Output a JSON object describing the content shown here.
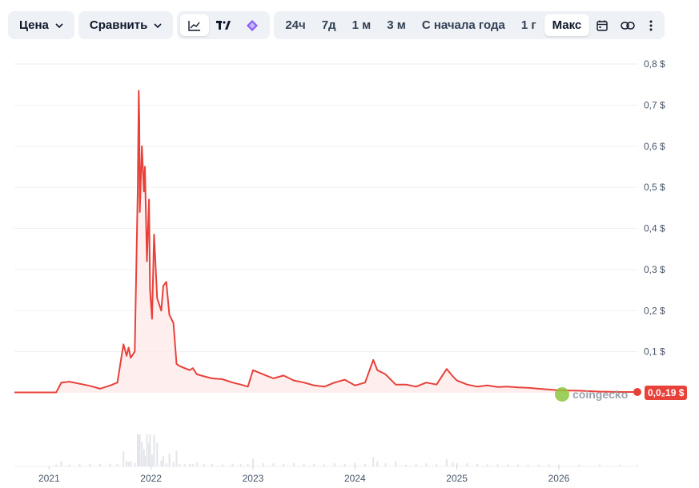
{
  "toolbar": {
    "price_dropdown": "Цена",
    "compare_dropdown": "Сравнить",
    "ranges": [
      "24ч",
      "7д",
      "1 м",
      "3 м",
      "С начала года",
      "1 г",
      "Макс"
    ],
    "active_range": "Макс"
  },
  "badge": {
    "current_price": "0,0₂19 $"
  },
  "watermark": {
    "text": "coingecko"
  },
  "colors": {
    "line": "#e8413a",
    "fill": "#fde8e7",
    "grid": "#eceff3",
    "volume": "#e2e5ea"
  },
  "chart_data": {
    "type": "line",
    "title": "",
    "xlabel": "",
    "ylabel": "",
    "ylim": [
      0,
      0.8
    ],
    "y_ticks": [
      0.1,
      0.2,
      0.3,
      0.4,
      0.5,
      0.6,
      0.7,
      0.8
    ],
    "y_tick_labels": [
      "0,1 $",
      "0,2 $",
      "0,3 $",
      "0,4 $",
      "0,5 $",
      "0,6 $",
      "0,7 $",
      "0,8 $"
    ],
    "x_range": [
      2020.66,
      2026.77
    ],
    "x_ticks": [
      2021,
      2022,
      2023,
      2024,
      2025,
      2026
    ],
    "x_tick_labels": [
      "2021",
      "2022",
      "2023",
      "2024",
      "2025",
      "2026"
    ],
    "grid": true,
    "series": [
      {
        "x": [
          2020.66,
          2021.07,
          2021.12,
          2021.2,
          2021.3,
          2021.4,
          2021.5,
          2021.6,
          2021.67,
          2021.73,
          2021.76,
          2021.78,
          2021.8,
          2021.84,
          2021.87,
          2021.88,
          2021.885,
          2021.89,
          2021.91,
          2021.93,
          2021.94,
          2021.96,
          2021.98,
          2021.99,
          2022.01,
          2022.03,
          2022.06,
          2022.1,
          2022.12,
          2022.15,
          2022.18,
          2022.22,
          2022.25,
          2022.28,
          2022.33,
          2022.38,
          2022.41,
          2022.45,
          2022.52,
          2022.6,
          2022.7,
          2022.8,
          2022.88,
          2022.95,
          2023.0,
          2023.1,
          2023.2,
          2023.3,
          2023.4,
          2023.5,
          2023.6,
          2023.7,
          2023.8,
          2023.9,
          2024.0,
          2024.1,
          2024.18,
          2024.22,
          2024.3,
          2024.4,
          2024.5,
          2024.6,
          2024.7,
          2024.8,
          2024.9,
          2024.96,
          2025.0,
          2025.1,
          2025.2,
          2025.3,
          2025.4,
          2025.5,
          2025.6,
          2025.7,
          2025.8,
          2025.9,
          2026.0,
          2026.2,
          2026.4,
          2026.6,
          2026.77
        ],
        "values": [
          0.001,
          0.001,
          0.025,
          0.027,
          0.022,
          0.017,
          0.01,
          0.018,
          0.025,
          0.118,
          0.09,
          0.11,
          0.085,
          0.1,
          0.5,
          0.735,
          0.66,
          0.44,
          0.6,
          0.49,
          0.55,
          0.32,
          0.47,
          0.25,
          0.18,
          0.385,
          0.23,
          0.2,
          0.26,
          0.27,
          0.19,
          0.17,
          0.07,
          0.065,
          0.06,
          0.055,
          0.06,
          0.045,
          0.04,
          0.035,
          0.033,
          0.025,
          0.02,
          0.015,
          0.055,
          0.045,
          0.035,
          0.042,
          0.03,
          0.025,
          0.018,
          0.015,
          0.025,
          0.032,
          0.018,
          0.025,
          0.08,
          0.055,
          0.045,
          0.02,
          0.02,
          0.015,
          0.025,
          0.02,
          0.058,
          0.04,
          0.03,
          0.02,
          0.015,
          0.018,
          0.014,
          0.015,
          0.013,
          0.012,
          0.01,
          0.008,
          0.006,
          0.005,
          0.003,
          0.002,
          0.0019
        ]
      }
    ]
  }
}
